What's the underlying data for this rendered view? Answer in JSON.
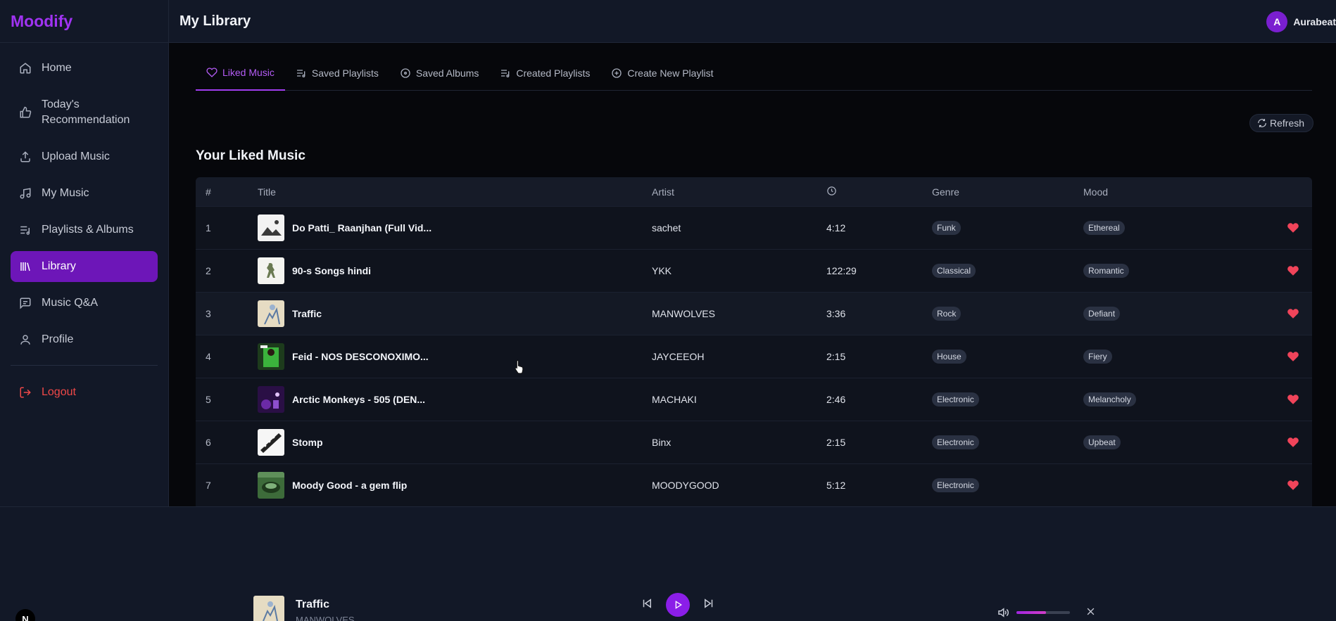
{
  "brand": "Moodify",
  "header": {
    "title": "My Library",
    "user": {
      "initial": "A",
      "name": "Aurabeat"
    }
  },
  "sidebar": {
    "items": [
      {
        "label": "Home",
        "icon": "home-icon"
      },
      {
        "label": "Today's Recommendation",
        "icon": "thumbs-up-icon"
      },
      {
        "label": "Upload Music",
        "icon": "upload-icon"
      },
      {
        "label": "My Music",
        "icon": "music-note-icon"
      },
      {
        "label": "Playlists & Albums",
        "icon": "playlist-icon"
      },
      {
        "label": "Library",
        "icon": "library-icon",
        "active": true
      },
      {
        "label": "Music Q&A",
        "icon": "chat-icon"
      },
      {
        "label": "Profile",
        "icon": "user-icon"
      }
    ],
    "logout": "Logout"
  },
  "tabs": [
    {
      "label": "Liked Music",
      "icon": "heart-icon",
      "active": true
    },
    {
      "label": "Saved Playlists",
      "icon": "playlist-icon"
    },
    {
      "label": "Saved Albums",
      "icon": "disc-icon"
    },
    {
      "label": "Created Playlists",
      "icon": "playlist-icon"
    },
    {
      "label": "Create New Playlist",
      "icon": "plus-circle-icon"
    }
  ],
  "refresh_label": "Refresh",
  "section_title": "Your Liked Music",
  "table": {
    "headers": {
      "num": "#",
      "title": "Title",
      "artist": "Artist",
      "duration_icon": "clock-icon",
      "genre": "Genre",
      "mood": "Mood"
    },
    "rows": [
      {
        "num": "1",
        "title": "Do Patti_ Raanjhan (Full Vid...",
        "artist": "sachet",
        "duration": "4:12",
        "genre": "Funk",
        "mood": "Ethereal"
      },
      {
        "num": "2",
        "title": "90-s Songs hindi",
        "artist": "YKK",
        "duration": "122:29",
        "genre": "Classical",
        "mood": "Romantic"
      },
      {
        "num": "3",
        "title": "Traffic",
        "artist": "MANWOLVES",
        "duration": "3:36",
        "genre": "Rock",
        "mood": "Defiant"
      },
      {
        "num": "4",
        "title": "Feid - NOS DESCONOXIMO...",
        "artist": "JAYCEEOH",
        "duration": "2:15",
        "genre": "House",
        "mood": "Fiery"
      },
      {
        "num": "5",
        "title": "Arctic Monkeys - 505 (DEN...",
        "artist": "MACHAKI",
        "duration": "2:46",
        "genre": "Electronic",
        "mood": "Melancholy"
      },
      {
        "num": "6",
        "title": "Stomp",
        "artist": "Binx",
        "duration": "2:15",
        "genre": "Electronic",
        "mood": "Upbeat"
      },
      {
        "num": "7",
        "title": "Moody Good - a gem flip",
        "artist": "MOODYGOOD",
        "duration": "5:12",
        "genre": "Electronic",
        "mood": ""
      }
    ]
  },
  "player": {
    "title": "Traffic",
    "artist": "MANWOLVES",
    "volume": 0.55
  },
  "badge": "N",
  "colors": {
    "accent": "#8b1ee8",
    "brand": "#a033f2",
    "heart": "#f0445a",
    "logout": "#f04848"
  }
}
